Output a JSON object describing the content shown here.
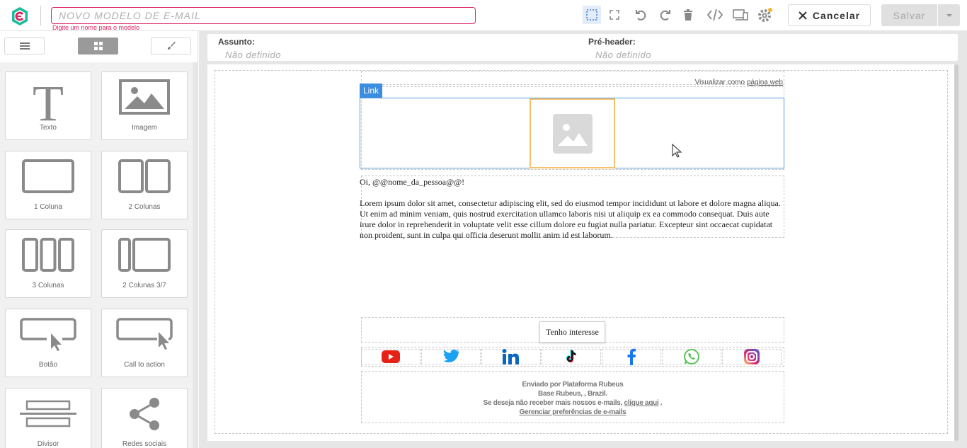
{
  "header": {
    "name_placeholder": "NOVO MODELO DE E-MAIL",
    "name_hint": "Digite um nome para o modelo",
    "cancel_label": "Cancelar",
    "save_label": "Salvar",
    "tools": [
      "select-outline-icon",
      "fullscreen-icon",
      "undo-icon",
      "redo-icon",
      "trash-icon",
      "code-icon",
      "responsive-preview-icon",
      "settings-icon"
    ]
  },
  "sidebar": {
    "tabs": [
      "rows-icon",
      "blocks-icon",
      "brush-icon"
    ],
    "active_tab": 1,
    "blocks": [
      {
        "label": "Texto",
        "icon": "text-icon"
      },
      {
        "label": "Imagem",
        "icon": "image-icon"
      },
      {
        "label": "1 Coluna",
        "icon": "one-column-icon"
      },
      {
        "label": "2 Colunas",
        "icon": "two-columns-icon"
      },
      {
        "label": "3 Colunas",
        "icon": "three-columns-icon"
      },
      {
        "label": "2 Colunas 3/7",
        "icon": "two-columns-37-icon"
      },
      {
        "label": "Botão",
        "icon": "button-icon"
      },
      {
        "label": "Call to action",
        "icon": "call-to-action-icon"
      },
      {
        "label": "Divisor",
        "icon": "divider-icon"
      },
      {
        "label": "Redes sociais",
        "icon": "share-icon"
      }
    ]
  },
  "meta": {
    "subject_label": "Assunto:",
    "subject_value": "Não definido",
    "preheader_label": "Pré-header:",
    "preheader_value": "Não definido"
  },
  "email": {
    "view_web_prefix": "Visualizar como",
    "view_web_link": "página web",
    "link_tag": "Link",
    "greeting": "Oi, @@nome_da_pessoa@@!",
    "body": "Lorem ipsum dolor sit amet, consectetur adipiscing elit, sed do eiusmod tempor incididunt ut labore et dolore magna aliqua. Ut enim ad minim veniam, quis nostrud exercitation ullamco laboris nisi ut aliquip ex ea commodo consequat. Duis aute irure dolor in reprehenderit in voluptate velit esse cillum dolore eu fugiat nulla pariatur. Excepteur sint occaecat cupidatat non proident, sunt in culpa qui officia deserunt mollit anim id est laborum.",
    "cta_label": "Tenho interesse",
    "social": [
      "youtube-icon",
      "twitter-icon",
      "linkedin-icon",
      "tiktok-icon",
      "facebook-icon",
      "whatsapp-icon",
      "instagram-icon"
    ],
    "footer_line1": "Enviado por Plataforma Rubeus",
    "footer_line2": "Base Rubeus, , Brazil.",
    "footer_unsub_prefix": "Se deseja não receber mais nossos e-mails,",
    "footer_unsub_link": "clique aqui",
    "footer_unsub_suffix": ".",
    "footer_prefs": "Gerenciar preferências de e-mails"
  },
  "colors": {
    "accent_pink": "#e0245e",
    "link_blue": "#3b8de0",
    "image_border": "#f5c16c"
  }
}
